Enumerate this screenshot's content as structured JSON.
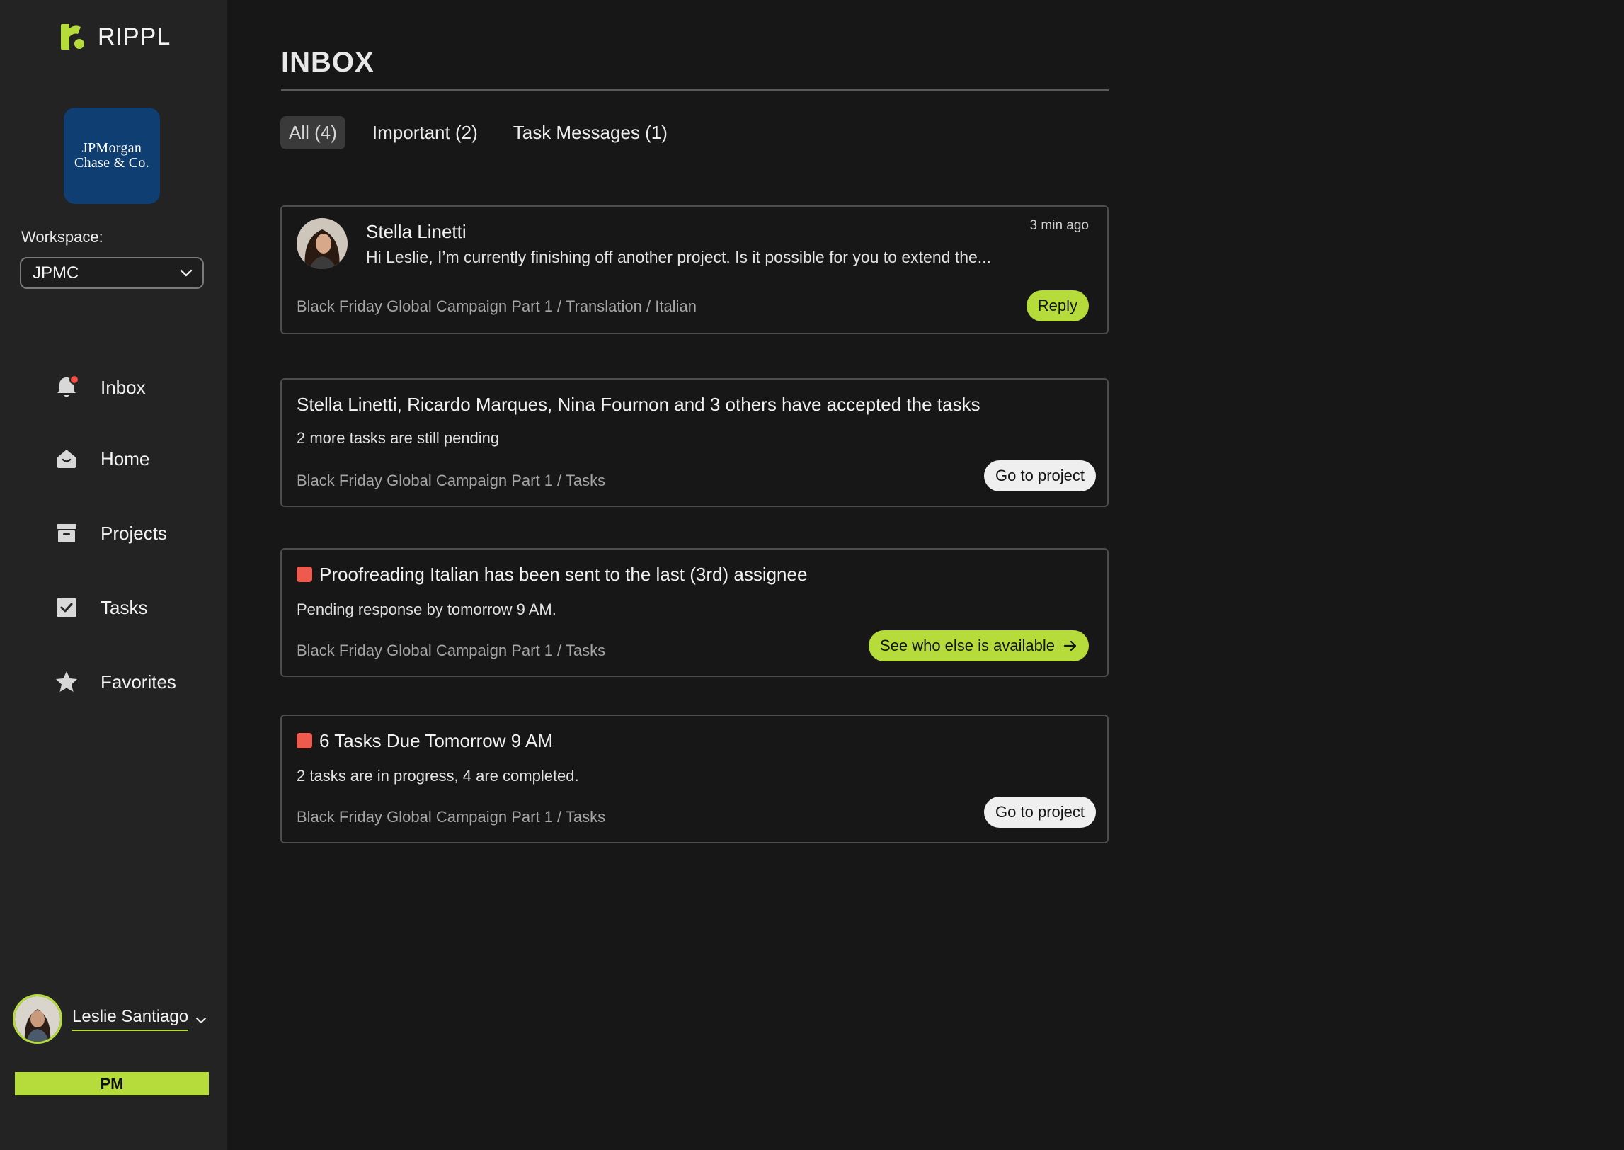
{
  "app": {
    "name": "RIPPL"
  },
  "colors": {
    "accent": "#b5dc3a",
    "alert": "#ef5a4f",
    "brand_tile": "#0f3e73"
  },
  "brand": {
    "line1": "JPMorgan",
    "line2": "Chase & Co."
  },
  "workspace": {
    "label": "Workspace:",
    "value": "JPMC"
  },
  "nav": [
    {
      "label": "Inbox",
      "icon": "bell-icon",
      "has_notification": true
    },
    {
      "label": "Home",
      "icon": "home-icon"
    },
    {
      "label": "Projects",
      "icon": "archive-box-icon"
    },
    {
      "label": "Tasks",
      "icon": "checkbox-icon"
    },
    {
      "label": "Favorites",
      "icon": "star-icon"
    }
  ],
  "user": {
    "name": "Leslie Santiago",
    "role": "PM"
  },
  "inbox": {
    "title": "INBOX",
    "tabs": [
      {
        "label": "All (4)",
        "active": true
      },
      {
        "label": "Important (2)",
        "active": false
      },
      {
        "label": "Task Messages (1)",
        "active": false
      }
    ],
    "messages": [
      {
        "sender": "Stella Linetti",
        "time": "3 min ago",
        "preview": "Hi Leslie, I’m currently finishing off another project. Is it possible for you to extend the...",
        "path": "Black Friday Global Campaign Part 1 / Translation / Italian",
        "action": "Reply"
      },
      {
        "title": "Stella Linetti, Ricardo Marques, Nina Fournon and 3 others have accepted the tasks",
        "subtitle": "2 more tasks are still pending",
        "path": "Black Friday Global Campaign Part 1 /  Tasks",
        "action": "Go to project"
      },
      {
        "title": "Proofreading Italian has been sent to the last (3rd) assignee",
        "subtitle": "Pending response by tomorrow 9 AM.",
        "path": "Black Friday Global Campaign Part 1 /  Tasks",
        "action": "See who else is available"
      },
      {
        "title": "6 Tasks Due Tomorrow 9 AM",
        "subtitle": "2 tasks are in progress, 4 are completed.",
        "path": "Black Friday Global Campaign Part 1 /  Tasks",
        "action": "Go to project"
      }
    ]
  }
}
